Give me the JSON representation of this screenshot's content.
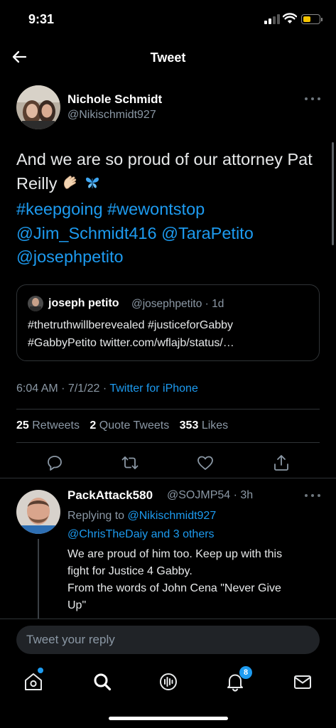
{
  "status_bar": {
    "time": "9:31"
  },
  "header": {
    "title": "Tweet"
  },
  "tweet": {
    "author_name": "Nichole Schmidt",
    "author_handle": "@Nikischmidt927",
    "text_plain": "And we are so proud of our attorney Pat Reilly",
    "hashtags": [
      "#keepgoing",
      "#wewontstop"
    ],
    "mentions": [
      "@Jim_Schmidt416",
      "@TaraPetito",
      "@josephpetito"
    ],
    "quote": {
      "author_name": "joseph petito",
      "author_handle": "@josephpetito",
      "age": "1d",
      "line1": "#thetruthwillberevealed #justiceforGabby",
      "line2": "#GabbyPetito twitter.com/wflajb/status/…"
    },
    "timestamp": "6:04 AM · 7/1/22",
    "source": "Twitter for iPhone",
    "stats": {
      "retweets_count": "25",
      "retweets_label": "Retweets",
      "quotes_count": "2",
      "quotes_label": "Quote Tweets",
      "likes_count": "353",
      "likes_label": "Likes"
    }
  },
  "reply": {
    "author_name": "PackAttack580",
    "author_handle": "@SOJMP54",
    "age": "3h",
    "replying_label": "Replying to",
    "replying_handle": "@Nikischmidt927",
    "replying_others": "@ChrisTheDaiy and 3 others",
    "text_line1": "We are proud of him too. Keep up with this",
    "text_line2": "fight for Justice 4 Gabby.",
    "text_line3": "From the words of John Cena \"Never Give",
    "text_line4": "Up\""
  },
  "composer": {
    "placeholder": "Tweet your reply"
  },
  "tab_bar": {
    "notifications_badge": "8"
  },
  "colors": {
    "accent": "#1d9bf0",
    "background": "#000000",
    "secondary_text": "#8b98a5",
    "divider": "#2f3336"
  },
  "icons": [
    "back-arrow-icon",
    "more-icon",
    "reply-icon",
    "retweet-icon",
    "like-icon",
    "share-icon",
    "home-icon",
    "search-icon",
    "spaces-icon",
    "notifications-icon",
    "messages-icon"
  ]
}
